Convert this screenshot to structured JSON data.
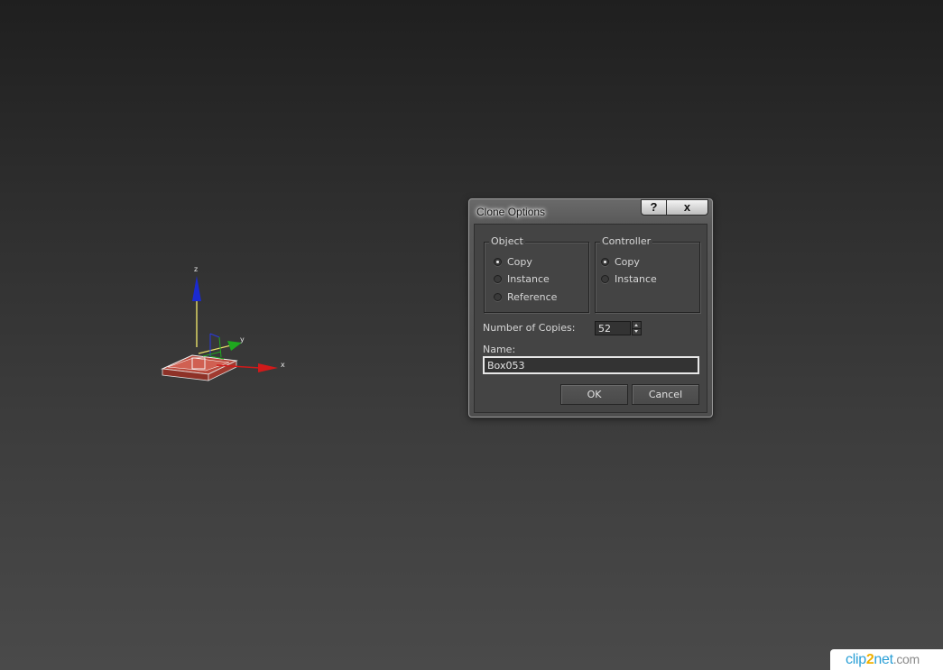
{
  "viewport": {
    "gizmo": {
      "x_label": "x",
      "y_label": "y",
      "z_label": "z",
      "x_color": "#d11a1a",
      "y_color": "#1fa81f",
      "z_color": "#1a2ad1",
      "object_color": "#c9584a"
    }
  },
  "dialog": {
    "title": "Clone Options",
    "help_label": "?",
    "close_label": "x",
    "object_group": {
      "title": "Object",
      "options": [
        {
          "label": "Copy",
          "checked": true
        },
        {
          "label": "Instance",
          "checked": false
        },
        {
          "label": "Reference",
          "checked": false
        }
      ]
    },
    "controller_group": {
      "title": "Controller",
      "options": [
        {
          "label": "Copy",
          "checked": true
        },
        {
          "label": "Instance",
          "checked": false
        }
      ]
    },
    "copies": {
      "label": "Number of Copies:",
      "value": "52"
    },
    "name": {
      "label": "Name:",
      "value": "Box053"
    },
    "ok_label": "OK",
    "cancel_label": "Cancel"
  },
  "watermark": {
    "part1": "clip",
    "part2": "2",
    "part3": "net",
    "part4": ".com"
  }
}
